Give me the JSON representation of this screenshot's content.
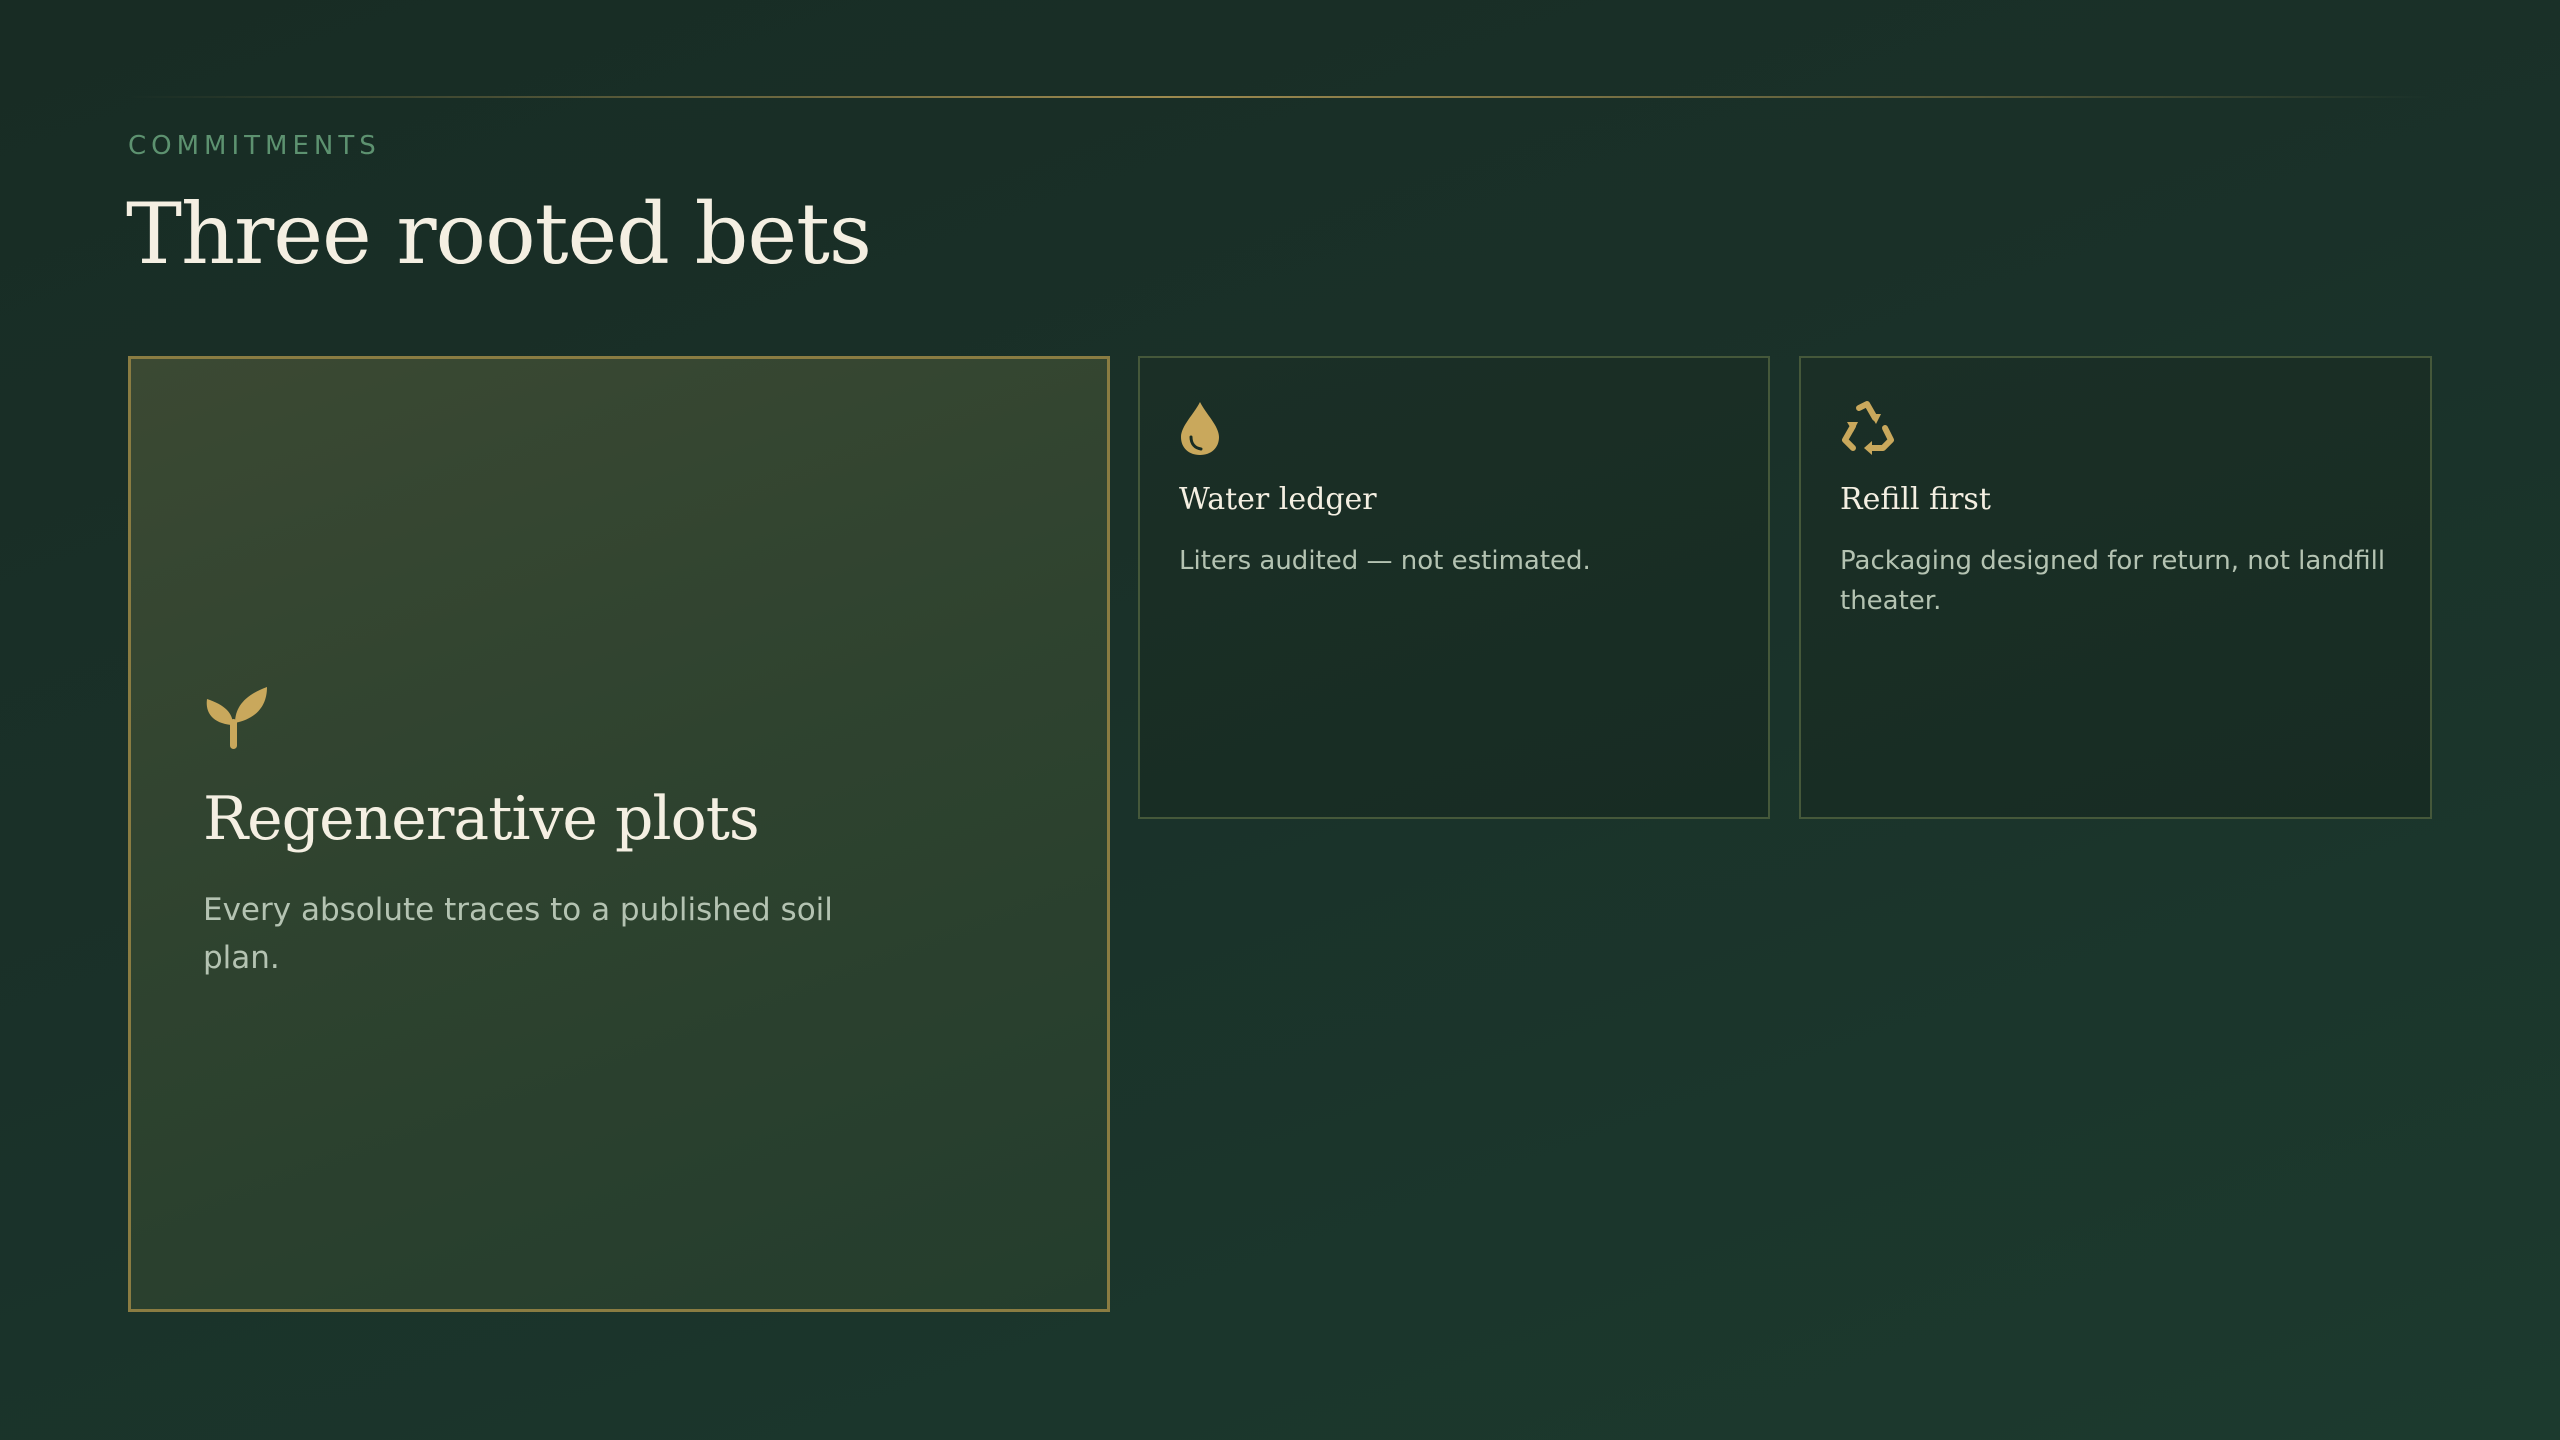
{
  "section": {
    "eyebrow": "COMMITMENTS",
    "title": "Three rooted bets"
  },
  "cards": [
    {
      "icon": "sprout-icon",
      "heading": "Regenerative plots",
      "text": "Every absolute traces to a published soil plan."
    },
    {
      "icon": "water-drop-icon",
      "heading": "Water ledger",
      "text": "Liters audited — not estimated."
    },
    {
      "icon": "recycle-icon",
      "heading": "Refill first",
      "text": "Packaging designed for return, not landfill theater."
    }
  ],
  "colors": {
    "background": "#1a3129",
    "accent_gold": "#c9a85c",
    "eyebrow_green": "#5d9270",
    "feature_border": "#8a7c42"
  }
}
